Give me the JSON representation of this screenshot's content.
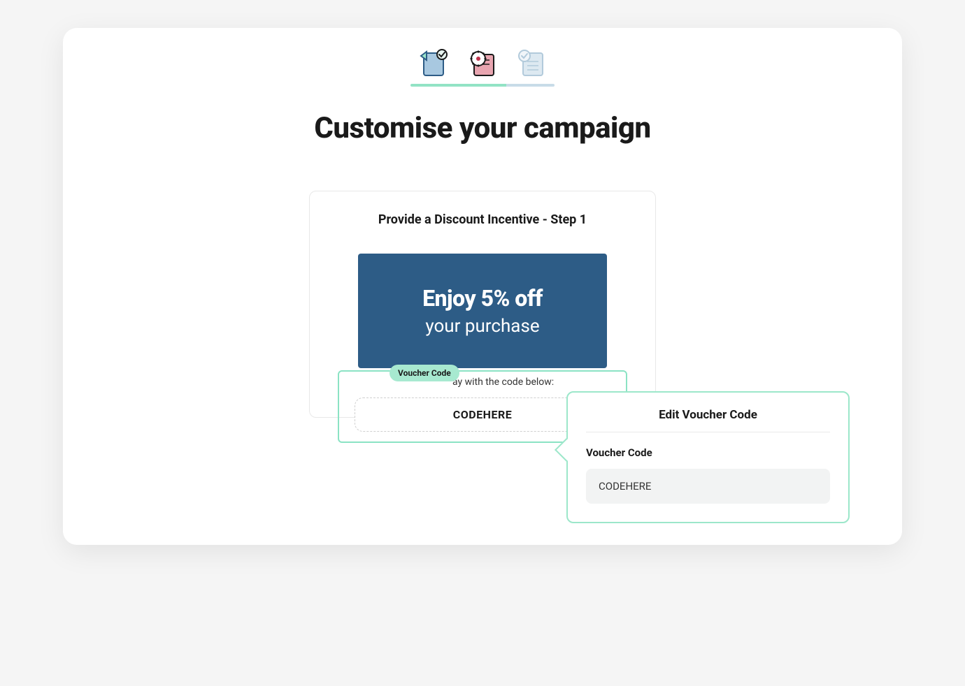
{
  "page": {
    "title": "Customise your campaign"
  },
  "stepper": {
    "steps": [
      {
        "name": "template",
        "done": true
      },
      {
        "name": "settings",
        "done": true
      },
      {
        "name": "review",
        "done": false
      }
    ]
  },
  "content": {
    "title": "Provide a Discount Incentive - Step 1",
    "promo": {
      "headline": "Enjoy 5% off",
      "subline": "your purchase"
    },
    "voucher": {
      "badge": "Voucher Code",
      "hint": "ay with the code below:",
      "code": "CODEHERE"
    }
  },
  "editPanel": {
    "title": "Edit Voucher Code",
    "fieldLabel": "Voucher Code",
    "fieldValue": "CODEHERE"
  },
  "colors": {
    "mint": "#9ce7ca",
    "mintLight": "#a7e9d0",
    "bannerBlue": "#2d5c86",
    "lightBlue": "#c8dce8"
  }
}
